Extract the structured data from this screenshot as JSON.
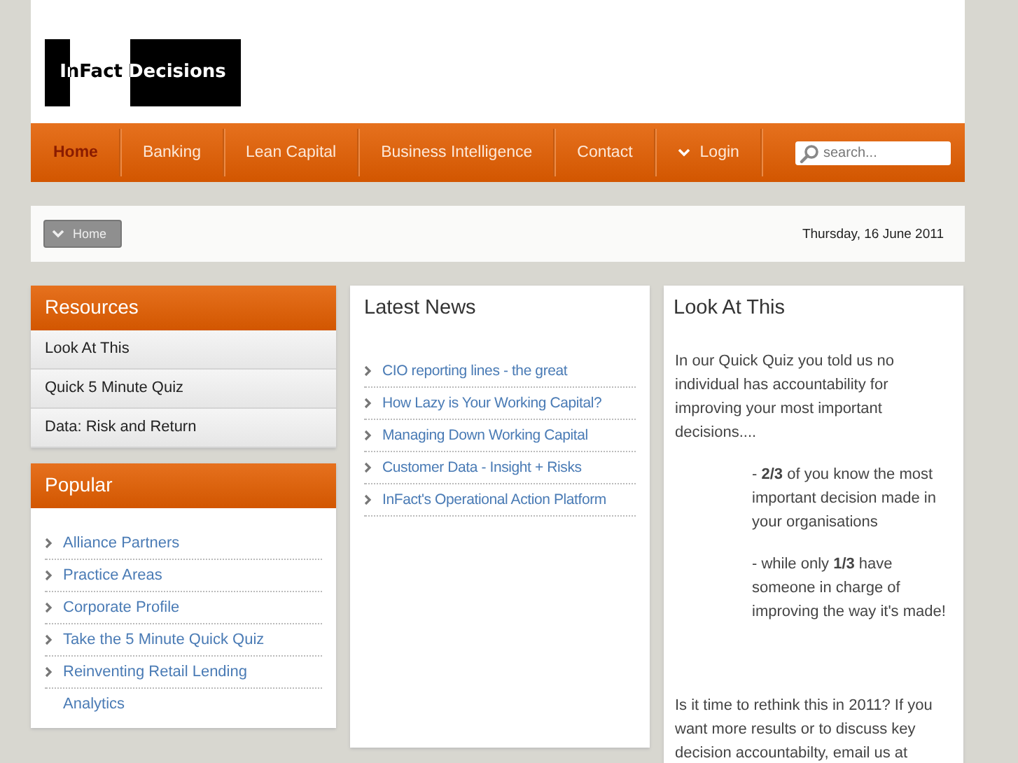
{
  "logo": {
    "part_1": "InFact",
    "part_2": "Decisions"
  },
  "nav": {
    "items": [
      {
        "label": "Home",
        "selected": true,
        "kind": "link"
      },
      {
        "label": "Banking",
        "selected": false,
        "kind": "link"
      },
      {
        "label": "Lean Capital",
        "selected": false,
        "kind": "link"
      },
      {
        "label": "Business Intelligence",
        "selected": false,
        "kind": "link"
      },
      {
        "label": "Contact",
        "selected": false,
        "kind": "link"
      },
      {
        "label": "Login",
        "selected": false,
        "kind": "dropdown"
      }
    ],
    "search": {
      "placeholder": "search..."
    }
  },
  "breadcrumb": {
    "button": "Home",
    "date": "Thursday, 16 June 2011"
  },
  "resources": {
    "title": "Resources",
    "items": [
      "Look At This",
      "Quick 5 Minute Quiz",
      "Data: Risk and Return"
    ]
  },
  "popular": {
    "title": "Popular",
    "items": [
      {
        "lines": [
          "Alliance Partners"
        ]
      },
      {
        "lines": [
          "Practice Areas"
        ]
      },
      {
        "lines": [
          "Corporate Profile"
        ]
      },
      {
        "lines": [
          "Take the 5 Minute Quick Quiz"
        ]
      },
      {
        "lines": [
          "Reinventing Retail Lending",
          "Analytics"
        ]
      }
    ]
  },
  "latest_news": {
    "title": "Latest News",
    "items": [
      "CIO reporting lines - the great",
      "How Lazy is Your Working Capital?",
      "Managing Down Working Capital",
      "Customer Data - Insight + Risks",
      "InFact's Operational Action Platform"
    ]
  },
  "look_at_this": {
    "title": "Look At This",
    "intro": "In our Quick Quiz you told us no individual has accountability for improving your most important decisions....",
    "points": [
      "- **2/3** of you know the most important decision made in your organisations",
      "- while only **1/3** have someone in charge of improving the way it's made!"
    ],
    "closing": "Is it time to rethink this in 2011? If you want more results or to discuss key decision accountabilty, email us at"
  }
}
